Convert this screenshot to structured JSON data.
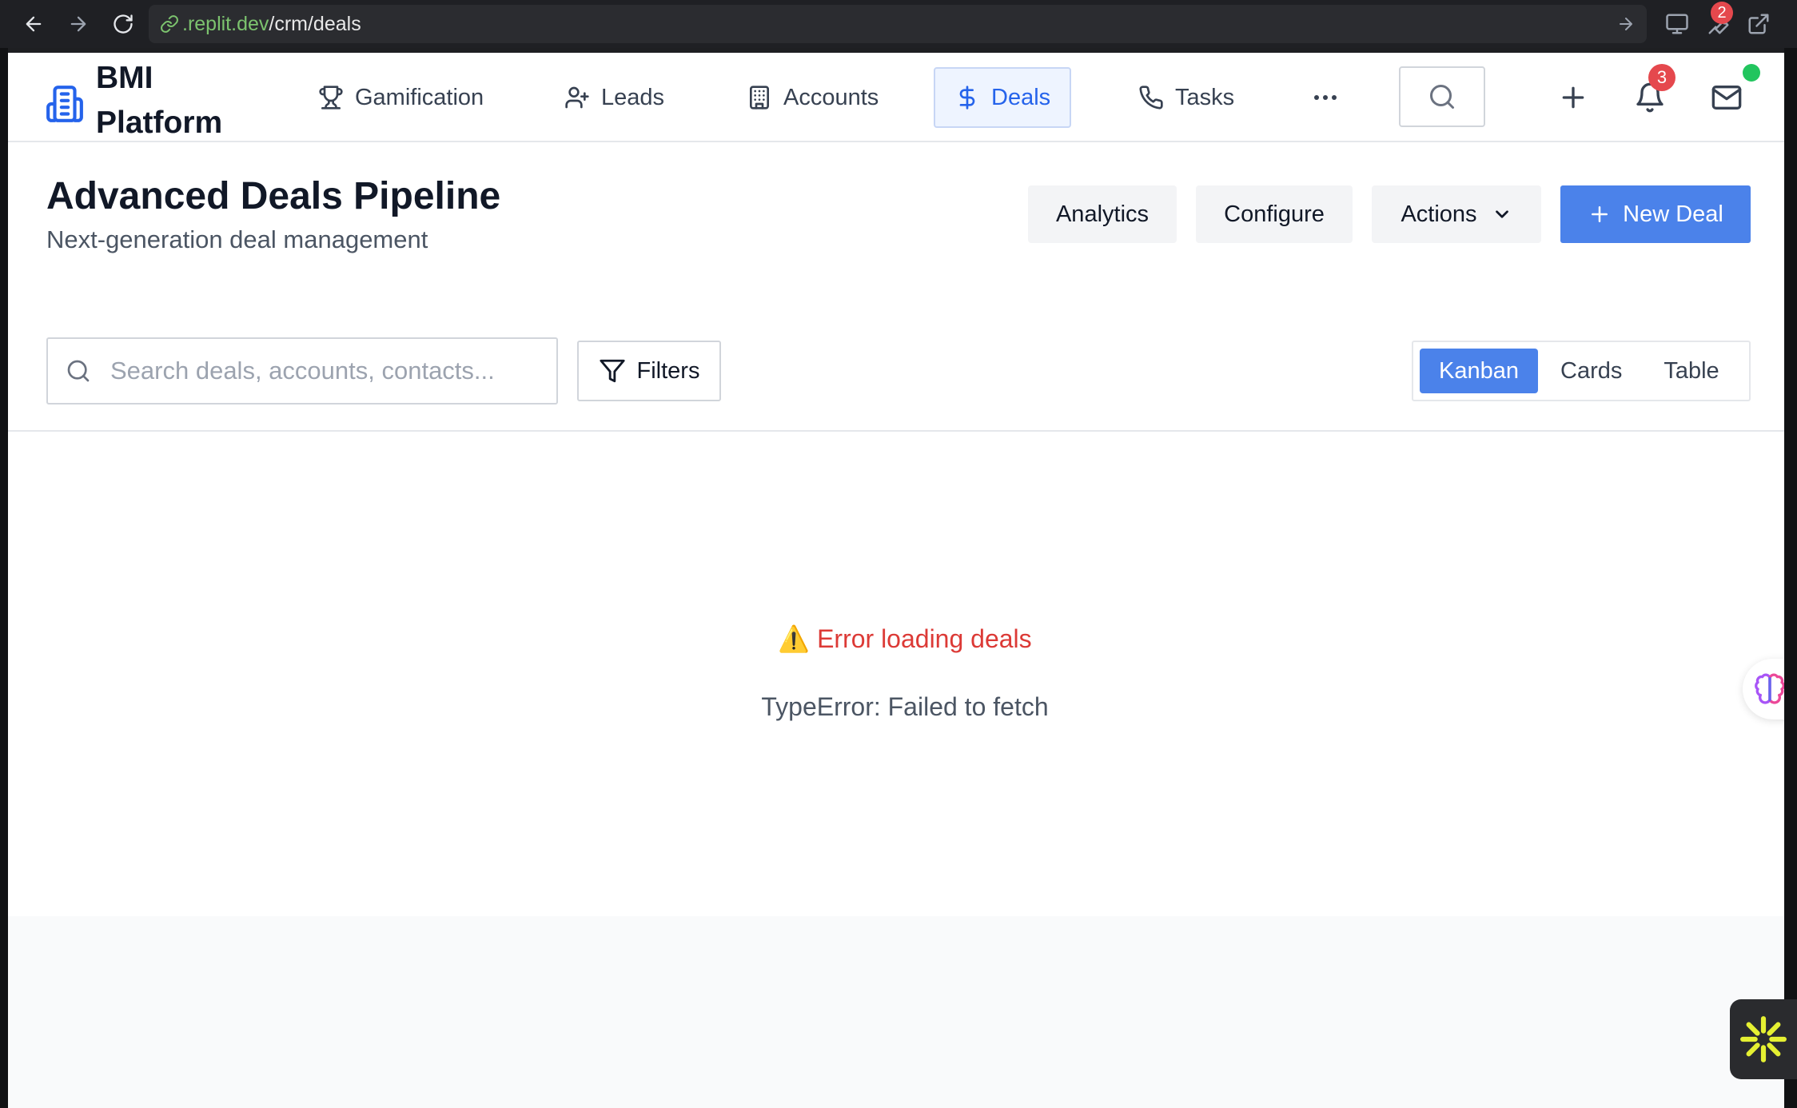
{
  "browser": {
    "url_host": ".replit.dev",
    "url_path": "/crm/deals",
    "extensions_badge": "2"
  },
  "nav": {
    "brand": "BMI Platform",
    "items": [
      {
        "label": "Gamification",
        "icon": "trophy-icon"
      },
      {
        "label": "Leads",
        "icon": "user-plus-icon"
      },
      {
        "label": "Accounts",
        "icon": "building-icon"
      },
      {
        "label": "Deals",
        "icon": "dollar-icon",
        "active": true
      },
      {
        "label": "Tasks",
        "icon": "phone-icon"
      }
    ],
    "more_icon": "more-horizontal-icon",
    "notifications_count": "3",
    "accent_color": "#2563eb"
  },
  "header": {
    "title": "Advanced Deals Pipeline",
    "subtitle": "Next-generation deal management",
    "analytics_label": "Analytics",
    "configure_label": "Configure",
    "actions_label": "Actions",
    "new_deal_label": "New Deal",
    "primary_color": "#4b82ea"
  },
  "toolbar": {
    "search_placeholder": "Search deals, accounts, contacts...",
    "filters_label": "Filters",
    "views": [
      "Kanban",
      "Cards",
      "Table"
    ],
    "active_view": "Kanban"
  },
  "error": {
    "icon": "⚠️",
    "title": "Error loading deals",
    "detail": "TypeError: Failed to fetch",
    "color": "#dc3a36"
  }
}
